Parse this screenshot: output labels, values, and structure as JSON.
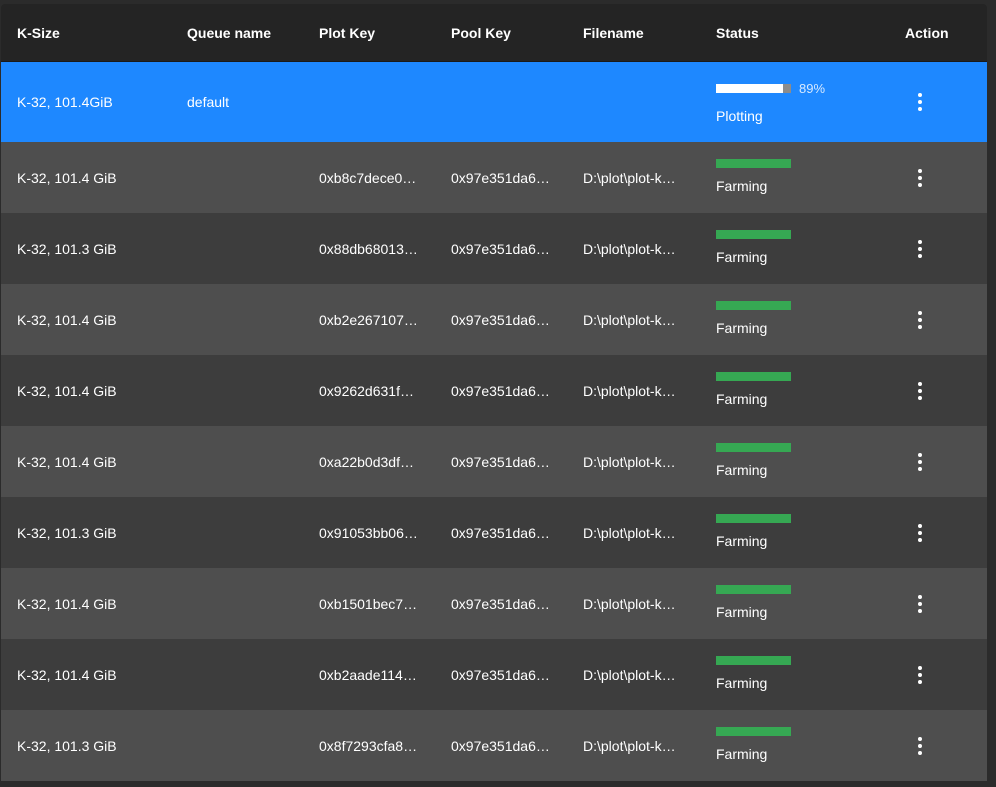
{
  "header": {
    "ksize": "K-Size",
    "queue": "Queue name",
    "plot_key": "Plot Key",
    "pool_key": "Pool Key",
    "filename": "Filename",
    "status": "Status",
    "action": "Action"
  },
  "active_row": {
    "ksize": "K-32, 101.4GiB",
    "queue": "default",
    "progress_percent": 89,
    "progress_label": "89%",
    "status": "Plotting"
  },
  "rows": [
    {
      "ksize": "K-32, 101.4 GiB",
      "plot_key": "0xb8c7dece0…",
      "pool_key": "0x97e351da6…",
      "filename": "D:\\plot\\plot-k…",
      "status": "Farming"
    },
    {
      "ksize": "K-32, 101.3 GiB",
      "plot_key": "0x88db68013…",
      "pool_key": "0x97e351da6…",
      "filename": "D:\\plot\\plot-k…",
      "status": "Farming"
    },
    {
      "ksize": "K-32, 101.4 GiB",
      "plot_key": "0xb2e267107…",
      "pool_key": "0x97e351da6…",
      "filename": "D:\\plot\\plot-k…",
      "status": "Farming"
    },
    {
      "ksize": "K-32, 101.4 GiB",
      "plot_key": "0x9262d631f…",
      "pool_key": "0x97e351da6…",
      "filename": "D:\\plot\\plot-k…",
      "status": "Farming"
    },
    {
      "ksize": "K-32, 101.4 GiB",
      "plot_key": "0xa22b0d3df…",
      "pool_key": "0x97e351da6…",
      "filename": "D:\\plot\\plot-k…",
      "status": "Farming"
    },
    {
      "ksize": "K-32, 101.3 GiB",
      "plot_key": "0x91053bb06…",
      "pool_key": "0x97e351da6…",
      "filename": "D:\\plot\\plot-k…",
      "status": "Farming"
    },
    {
      "ksize": "K-32, 101.4 GiB",
      "plot_key": "0xb1501bec7…",
      "pool_key": "0x97e351da6…",
      "filename": "D:\\plot\\plot-k…",
      "status": "Farming"
    },
    {
      "ksize": "K-32, 101.4 GiB",
      "plot_key": "0xb2aade114…",
      "pool_key": "0x97e351da6…",
      "filename": "D:\\plot\\plot-k…",
      "status": "Farming"
    },
    {
      "ksize": "K-32, 101.3 GiB",
      "plot_key": "0x8f7293cfa8…",
      "pool_key": "0x97e351da6…",
      "filename": "D:\\plot\\plot-k…",
      "status": "Farming"
    }
  ],
  "colors": {
    "header_bg": "#242424",
    "active_row_bg": "#1e88ff",
    "row_even_bg": "#4e4e4e",
    "row_odd_bg": "#3d3d3d",
    "farming_bar": "#36a853",
    "progress_fill": "#ffffff",
    "progress_track": "#8c8c8c"
  },
  "icons": {
    "action": "more-vert-icon"
  }
}
